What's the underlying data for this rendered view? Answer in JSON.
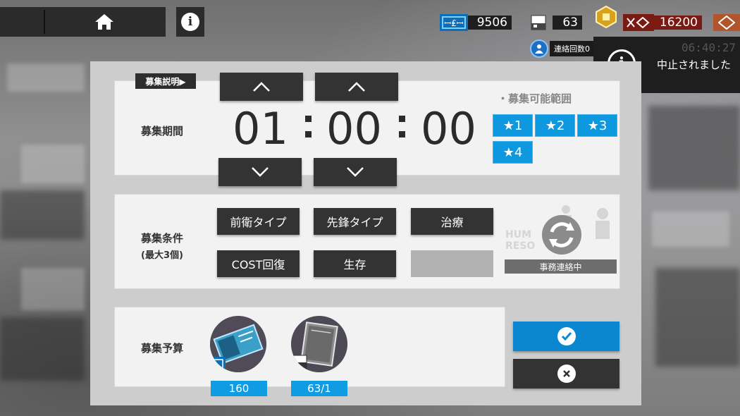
{
  "top_bar": {
    "resources": {
      "orundum": "9506",
      "permits": "63",
      "lmd": "16200"
    },
    "notification": {
      "label": "連絡回数",
      "count": "0"
    },
    "toast": {
      "time": "06:40:27",
      "message": "中止されました"
    }
  },
  "recruit": {
    "explain_label": "募集説明▶",
    "duration_label": "募集期間",
    "hours": "01",
    "minutes": "00",
    "seconds": "00",
    "range_title": "・募集可能範囲",
    "stars": [
      "★1",
      "★2",
      "★3",
      "★4"
    ],
    "conditions_label": "募集条件",
    "conditions_sub": "(最大3個)",
    "tags": [
      "前衛タイプ",
      "先鋒タイプ",
      "治療",
      "COST回復",
      "生存"
    ],
    "hr_status": "事務連絡中",
    "budget_label": "募集予算",
    "budget_items": [
      {
        "name": "ticket-icon",
        "count": "160"
      },
      {
        "name": "permit-icon",
        "count": "63/1"
      }
    ]
  },
  "colors": {
    "accent_blue": "#0b87cf",
    "button_dark": "#333333",
    "panel": "#f2f2f2"
  }
}
